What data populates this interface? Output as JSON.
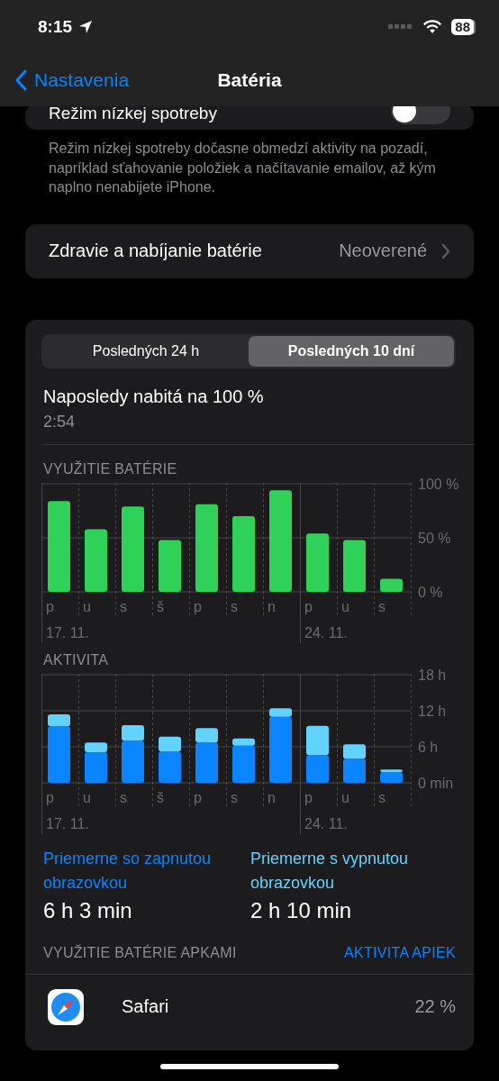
{
  "status_bar": {
    "time": "8:15",
    "battery": "88"
  },
  "nav": {
    "back": "Nastavenia",
    "title": "Batéria"
  },
  "low_power": {
    "label": "Režim nízkej spotreby",
    "on": false,
    "footnote": "Režim nízkej spotreby dočasne obmedzí aktivity na pozadí, napríklad sťahovanie položiek a načítavanie emailov, až kým naplno nenabijete iPhone."
  },
  "health": {
    "label": "Zdravie a nabíjanie batérie",
    "value": "Neoverené"
  },
  "range_tabs": [
    {
      "label": "Posledných 24 h",
      "selected": false
    },
    {
      "label": "Posledných 10 dní",
      "selected": true
    }
  ],
  "last_charged": {
    "label": "Naposledy nabitá na 100 %",
    "time": "2:54"
  },
  "battery_chart": {
    "chart_data": {
      "type": "bar",
      "title": "VYUŽITIE BATÉRIE",
      "categories": [
        "p",
        "u",
        "s",
        "š",
        "p",
        "s",
        "n",
        "p",
        "u",
        "s"
      ],
      "series": [
        {
          "color": "#30d158",
          "values": [
            84,
            58,
            79,
            48,
            81,
            70,
            94,
            54,
            48,
            12
          ]
        }
      ],
      "ylim": [
        0,
        100
      ],
      "yticks": [
        {
          "value": 0,
          "label": "0 %"
        },
        {
          "value": 50,
          "label": "50 %"
        },
        {
          "value": 100,
          "label": "100 %"
        }
      ]
    },
    "date_labels": [
      "17. 11.",
      "24. 11."
    ]
  },
  "activity_chart": {
    "chart_data": {
      "type": "bar",
      "title": "AKTIVITA",
      "stacked": true,
      "categories": [
        "p",
        "u",
        "s",
        "š",
        "p",
        "s",
        "n",
        "p",
        "u",
        "s"
      ],
      "series": [
        {
          "color": "#0a84ff",
          "values": [
            9.4,
            5.1,
            7,
            5.2,
            6.7,
            6.2,
            11,
            4.6,
            4,
            1.8
          ]
        },
        {
          "color": "#64d2ff",
          "values": [
            2,
            1.6,
            2.6,
            2.5,
            2.4,
            1.2,
            1.4,
            4.9,
            2.4,
            0.4
          ]
        }
      ],
      "ylim": [
        0,
        18
      ],
      "yticks": [
        {
          "value": 0,
          "label": "0 min"
        },
        {
          "value": 6,
          "label": "6 h"
        },
        {
          "value": 12,
          "label": "12 h"
        },
        {
          "value": 18,
          "label": "18 h"
        }
      ]
    },
    "date_labels": [
      "17. 11.",
      "24. 11."
    ]
  },
  "averages": [
    {
      "label": "Priemerne so zapnutou obrazovkou",
      "value": "6 h 3 min",
      "color": "#0a84ff"
    },
    {
      "label": "Priemerne s vypnutou obrazovkou",
      "value": "2 h 10 min",
      "color": "#64d2ff"
    }
  ],
  "apps_header": {
    "title": "VYUŽITIE BATÉRIE APKAMI",
    "action": "AKTIVITA APIEK"
  },
  "apps": [
    {
      "name": "Safari",
      "value": "22 %"
    }
  ]
}
